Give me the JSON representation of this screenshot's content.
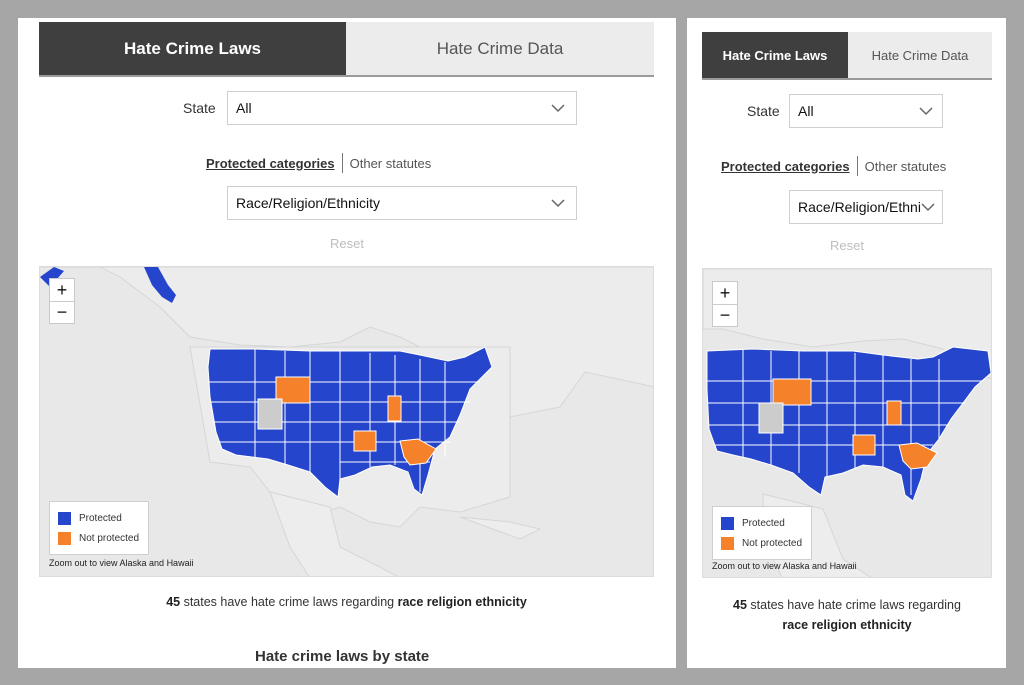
{
  "tabs": {
    "laws": "Hate Crime Laws",
    "data": "Hate Crime Data"
  },
  "state_filter": {
    "label": "State",
    "value": "All"
  },
  "categories": {
    "active": "Protected categories",
    "other": "Other statutes"
  },
  "category_select": {
    "value": "Race/Religion/Ethnicity",
    "value_truncated": "Race/Religion/Ethni"
  },
  "reset_label": "Reset",
  "zoom": {
    "in": "+",
    "out": "−"
  },
  "legend": {
    "protected": "Protected",
    "not_protected": "Not protected"
  },
  "zoom_note": "Zoom out to view Alaska and Hawaii",
  "summary": {
    "count": "45",
    "text": "states have hate crime laws regarding",
    "topic": "race religion ethnicity"
  },
  "section_title": "Hate crime laws by state",
  "colors": {
    "protected": "#2545cc",
    "not_protected": "#f5812a",
    "no_data": "#cccccc",
    "active_tab": "#3f3f3f"
  }
}
